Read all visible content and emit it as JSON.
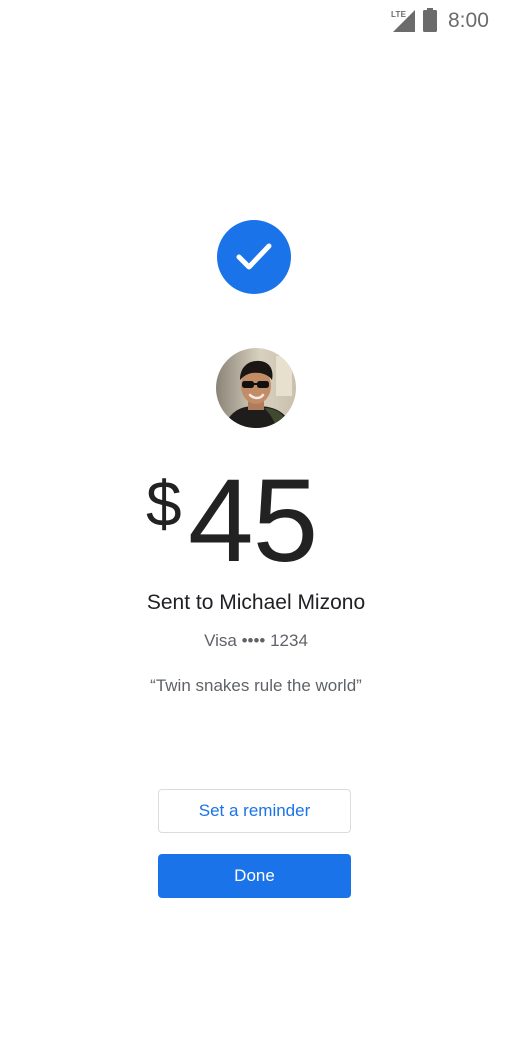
{
  "status_bar": {
    "network": "LTE",
    "time": "8:00",
    "signal_icon": "cell-signal-icon",
    "battery_icon": "battery-icon"
  },
  "confirmation": {
    "icon": "check-icon",
    "accent_color": "#1a73e8"
  },
  "recipient": {
    "avatar": "recipient-avatar",
    "sent_to_text": "Sent to Michael Mizono"
  },
  "amount": {
    "currency_symbol": "$",
    "value": "45"
  },
  "payment": {
    "method": "Visa •••• 1234"
  },
  "memo": {
    "text": "“Twin snakes rule the world”"
  },
  "actions": {
    "reminder_label": "Set a reminder",
    "done_label": "Done"
  }
}
